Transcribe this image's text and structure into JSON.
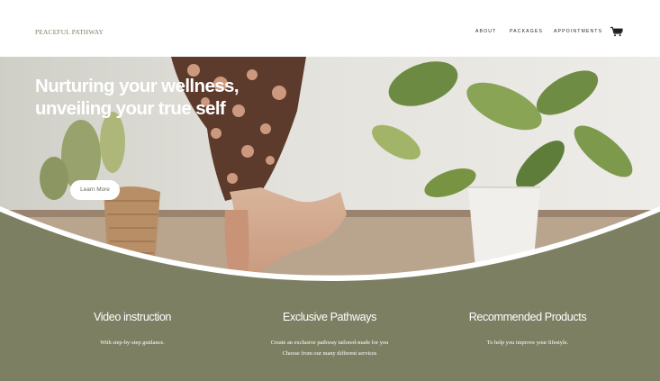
{
  "header": {
    "logo": "PEACEFUL PATHWAY",
    "nav": [
      "ABOUT",
      "PACKAGES",
      "APPOINTMENTS"
    ],
    "cart_count": "0",
    "cart_icon": "cart-icon"
  },
  "hero": {
    "title_line1": "Nurturing your wellness,",
    "title_line2": "unveiling your true self",
    "button_label": "Learn More"
  },
  "features": [
    {
      "title": "Video instruction",
      "text1": "With step-by-step guidance.",
      "text2": ""
    },
    {
      "title": "Exclusive Pathways",
      "text1": "Create an exclusive pathway tailored-made for you",
      "text2": "Choose from our many different services"
    },
    {
      "title": "Recommended Products",
      "text1": "To help you improve your lifestyle.",
      "text2": ""
    }
  ],
  "colors": {
    "accent": "#7d7f62",
    "white": "#ffffff"
  }
}
